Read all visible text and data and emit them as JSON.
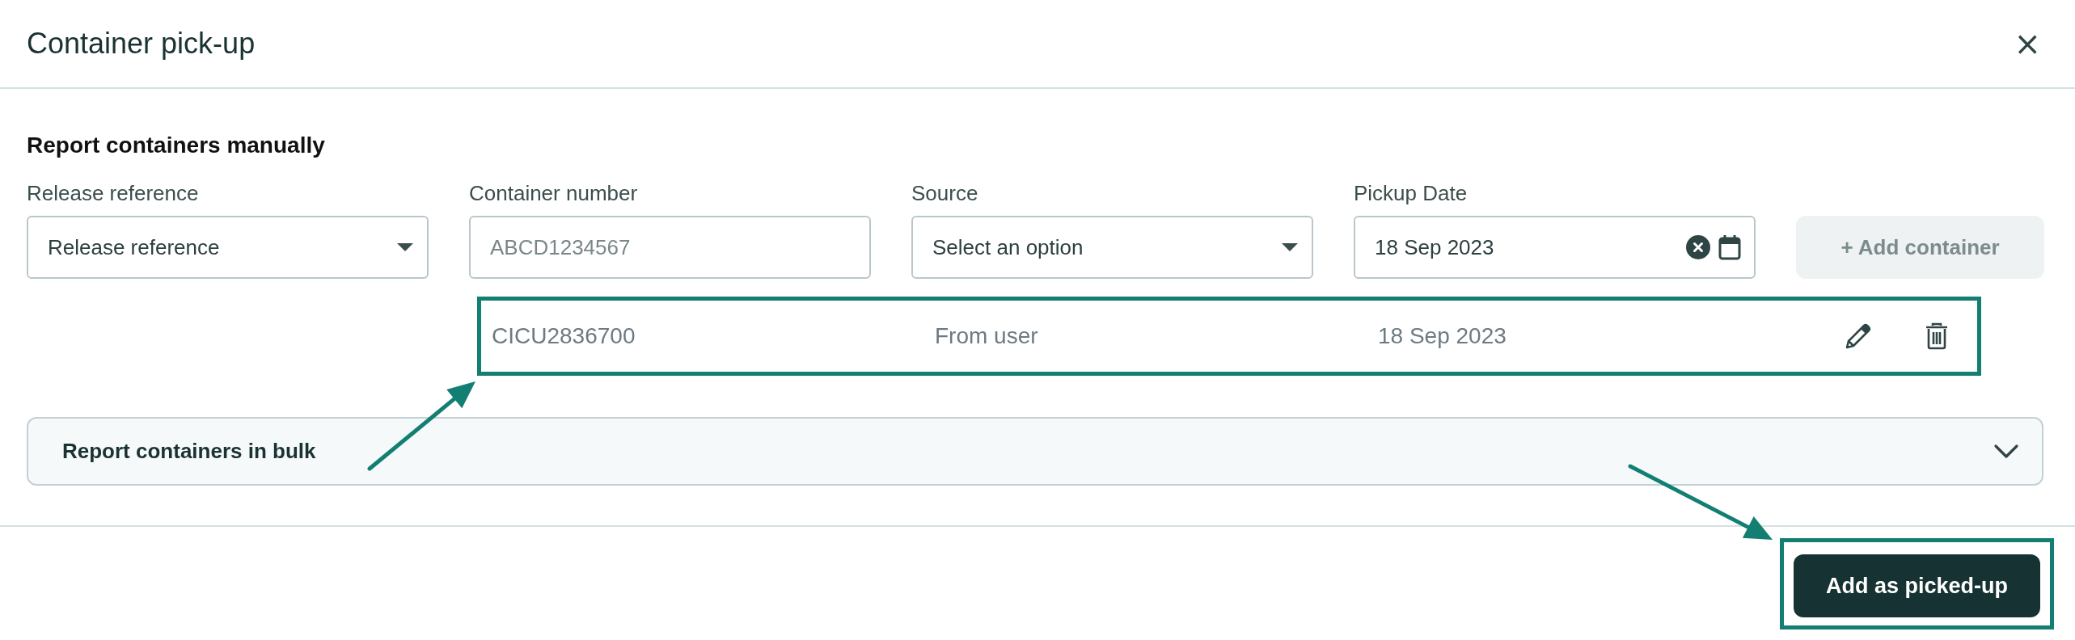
{
  "dialog": {
    "title": "Container pick-up",
    "close_icon": "×"
  },
  "manual": {
    "heading": "Report containers manually",
    "fields": [
      {
        "kind": "select",
        "label": "Release reference",
        "placeholder": "Release reference"
      },
      {
        "kind": "text",
        "label": "Container number",
        "placeholder": "ABCD1234567"
      },
      {
        "kind": "select",
        "label": "Source",
        "placeholder": "Select an option"
      },
      {
        "kind": "date",
        "label": "Pickup Date",
        "value": "18 Sep 2023"
      }
    ],
    "add_button": {
      "label": "+ Add container",
      "disabled": true
    }
  },
  "containers": [
    {
      "number": "CICU2836700",
      "source": "From user",
      "date": "18 Sep 2023",
      "highlighted": true
    }
  ],
  "bulk": {
    "title": "Report containers in bulk",
    "expanded": false
  },
  "footer": {
    "primary_button": {
      "label": "Add as picked-up",
      "highlighted": true
    }
  }
}
